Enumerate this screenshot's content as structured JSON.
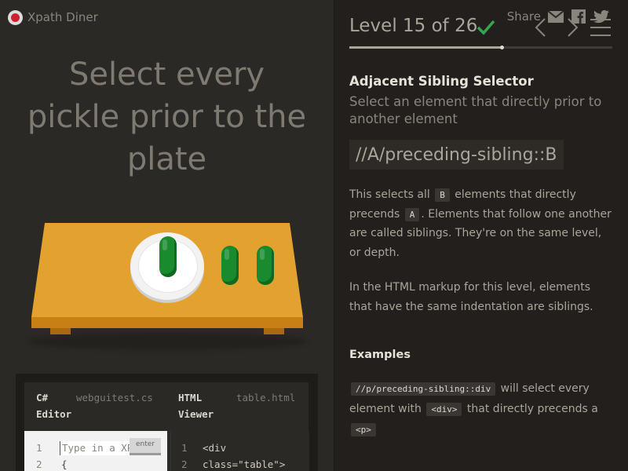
{
  "brand": {
    "name": "Xpath Diner"
  },
  "share": {
    "label": "Share",
    "icons": [
      "mail-icon",
      "facebook-icon",
      "twitter-icon"
    ]
  },
  "instruction": {
    "line1": "Select every",
    "line2": "pickle prior to the",
    "line3": "plate"
  },
  "editor": {
    "left_title_line1": "C#",
    "left_title_line2": "Editor",
    "left_file": "webguitest.cs",
    "right_title_line1": "HTML",
    "right_title_line2": "Viewer",
    "right_file": "table.html",
    "input_placeholder": "Type in a XPath",
    "enter_label": "enter",
    "left_lines": [
      "1",
      "2"
    ],
    "left_code_line2": "{",
    "right_lines": [
      "1",
      "2"
    ],
    "right_code_line1": "<div",
    "right_code_line2": "class=\"table\">"
  },
  "level": {
    "text": "Level 15 of 26",
    "current": 15,
    "total": 26,
    "progress_fraction": 0.577,
    "completed": true
  },
  "lesson": {
    "title": "Adjacent Sibling Selector",
    "subtitle": "Select an element that directly prior to another element",
    "syntax": "//A/preceding-sibling::B",
    "desc1_a": "This selects all",
    "desc1_tag_b": "B",
    "desc1_b": "elements that directly precends",
    "desc1_tag_a": "A",
    "desc1_c": ". Elements that follow one another are called siblings. They're on the same level, or depth.",
    "desc2": "In the HTML markup for this level, elements that have the same indentation are siblings.",
    "examples_title": "Examples",
    "example_code": "//p/preceding-sibling::div",
    "example_a": "will select every element with",
    "example_tag_div": "<div>",
    "example_b": "that directly precends a",
    "example_tag_p": "<p>"
  },
  "colors": {
    "accent_check": "#2fa84f",
    "table": "#e3a22f",
    "pickle": "#1a8a2e",
    "plate": "#ffffff"
  }
}
